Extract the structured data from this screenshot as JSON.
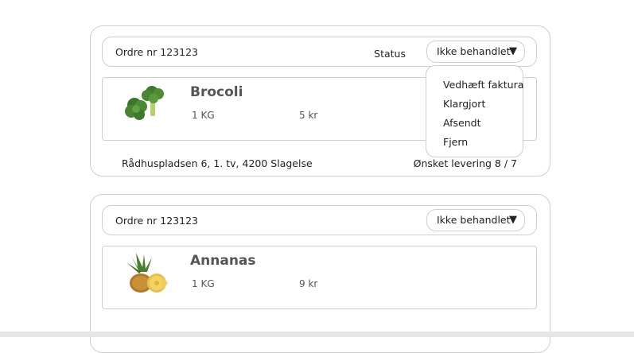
{
  "orders": [
    {
      "order_nr": "Ordre nr 123123",
      "status_label": "Status",
      "status_value": "Ikke behandlet",
      "product": {
        "name": "Brocoli",
        "quantity": "1 KG",
        "price": "5 kr",
        "image_icon": "broccoli-image"
      },
      "address": "Rådhuspladsen 6, 1. tv, 4200 Slagelse",
      "delivery": "Ønsket levering 8 / 7"
    },
    {
      "order_nr": "Ordre nr 123123",
      "status_value": "Ikke behandlet",
      "product": {
        "name": "Annanas",
        "quantity": "1 KG",
        "price": "9 kr",
        "image_icon": "pineapple-image"
      }
    }
  ],
  "dropdown": {
    "items": [
      "Vedhæft faktura",
      "Klargjort",
      "Afsendt",
      "Fjern"
    ]
  },
  "icons": {
    "caret": "caret-down-icon"
  },
  "colors": {
    "border": "#cfcfcf",
    "product_text": "#555555"
  }
}
